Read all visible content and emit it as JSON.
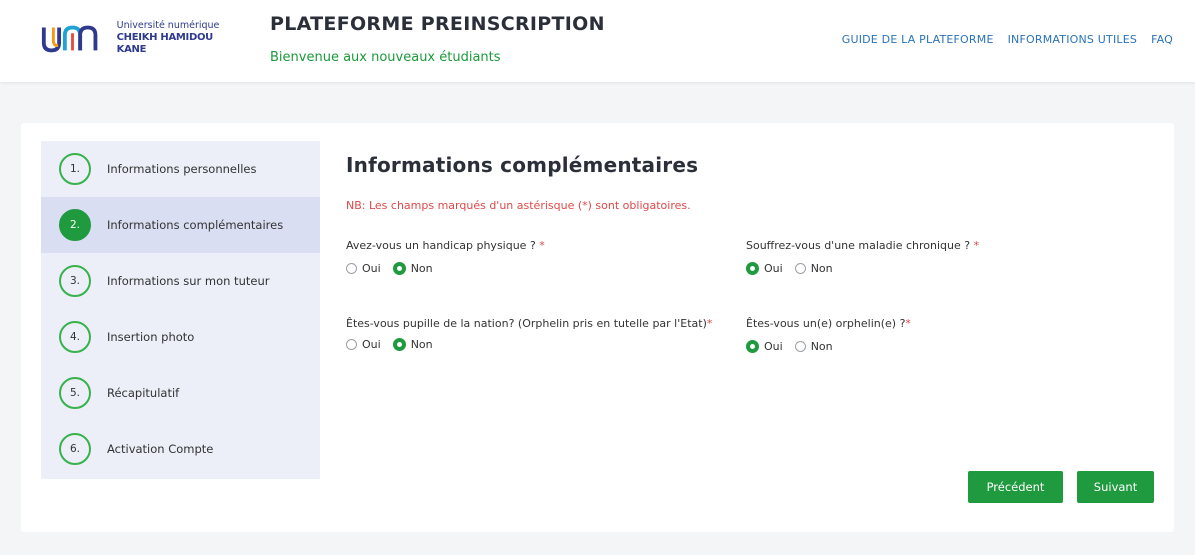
{
  "header": {
    "logo_line1": "Université numérique",
    "logo_line2": "CHEIKH HAMIDOU KANE",
    "title": "PLATEFORME PREINSCRIPTION",
    "subtitle": "Bienvenue aux nouveaux étudiants",
    "nav": [
      "GUIDE DE LA PLATEFORME",
      "INFORMATIONS UTILES",
      "FAQ"
    ]
  },
  "steps": [
    {
      "num": "1.",
      "label": "Informations personnelles",
      "active": false
    },
    {
      "num": "2.",
      "label": "Informations complémentaires",
      "active": true
    },
    {
      "num": "3.",
      "label": "Informations sur mon tuteur",
      "active": false
    },
    {
      "num": "4.",
      "label": "Insertion photo",
      "active": false
    },
    {
      "num": "5.",
      "label": "Récapitulatif",
      "active": false
    },
    {
      "num": "6.",
      "label": "Activation Compte",
      "active": false
    }
  ],
  "form": {
    "title": "Informations complémentaires",
    "note": "NB: Les champs marqués d'un astérisque (*) sont obligatoires.",
    "questions": [
      {
        "label": "Avez-vous un handicap physique ?",
        "required": "*",
        "options": [
          "Oui",
          "Non"
        ],
        "selected": "Non"
      },
      {
        "label": "Souffrez-vous d'une maladie chronique ?",
        "required": "*",
        "options": [
          "Oui",
          "Non"
        ],
        "selected": "Oui"
      },
      {
        "label": "Êtes-vous pupille de la nation? (Orphelin pris en tutelle par l'Etat)",
        "required": "*",
        "options": [
          "Oui",
          "Non"
        ],
        "selected": "Non"
      },
      {
        "label": "Êtes-vous un(e) orphelin(e) ?",
        "required": "*",
        "options": [
          "Oui",
          "Non"
        ],
        "selected": "Oui"
      }
    ]
  },
  "buttons": {
    "prev": "Précédent",
    "next": "Suivant"
  },
  "colors": {
    "accent": "#1f9a3f",
    "required": "#e04848",
    "link": "#2a73b8"
  }
}
